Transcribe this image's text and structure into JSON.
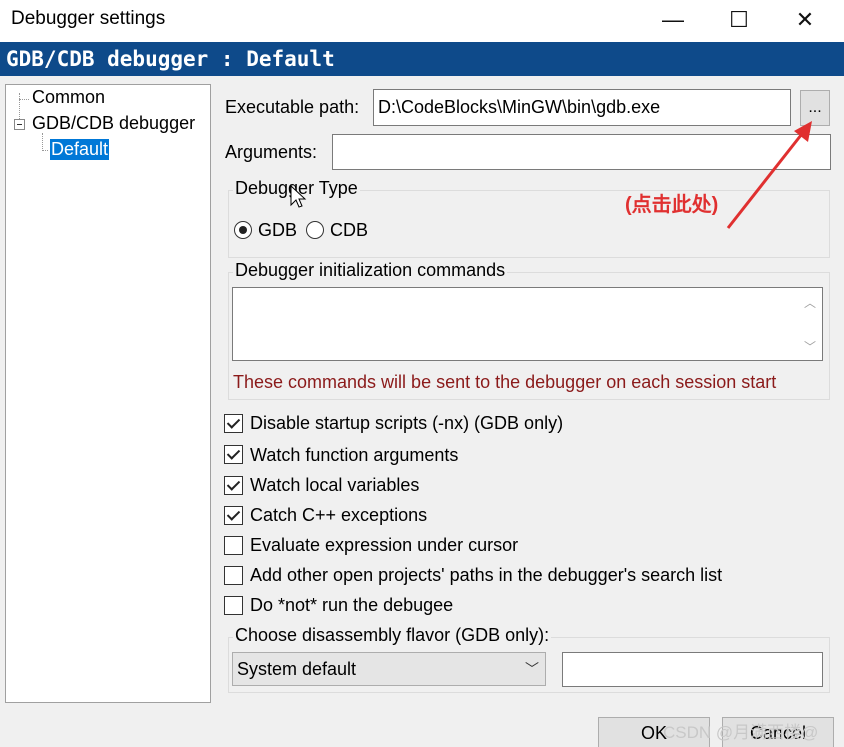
{
  "window": {
    "title": "Debugger settings",
    "minimize_label": "—",
    "maximize_label": "☐",
    "close_label": "✕"
  },
  "header": {
    "title": "GDB/CDB debugger : Default"
  },
  "tree": {
    "items": [
      {
        "label": "Common"
      },
      {
        "label": "GDB/CDB debugger"
      },
      {
        "label": "Default"
      }
    ]
  },
  "form": {
    "exe_label": "Executable path:",
    "exe_value": "D:\\CodeBlocks\\MinGW\\bin\\gdb.exe",
    "browse_label": "...",
    "args_label": "Arguments:",
    "args_value": "",
    "debugger_type": {
      "legend": "Debugger Type",
      "options": [
        "GDB",
        "CDB"
      ],
      "selected": "GDB"
    },
    "init_commands": {
      "legend": "Debugger initialization commands",
      "value": "",
      "note": "These commands will be sent to the debugger on each session start"
    },
    "checkboxes": [
      {
        "label": "Disable startup scripts (-nx) (GDB only)",
        "checked": true
      },
      {
        "label": "Watch function arguments",
        "checked": true
      },
      {
        "label": "Watch local variables",
        "checked": true
      },
      {
        "label": "Catch C++ exceptions",
        "checked": true
      },
      {
        "label": "Evaluate expression under cursor",
        "checked": false
      },
      {
        "label": "Add other open projects' paths in the debugger's search list",
        "checked": false
      },
      {
        "label": "Do *not* run the debugee",
        "checked": false
      }
    ],
    "flavor": {
      "legend": "Choose disassembly flavor (GDB only):",
      "selected": "System default",
      "extra_value": ""
    }
  },
  "footer": {
    "ok_label": "OK",
    "cancel_label": "Cancel"
  },
  "annotation": {
    "text": "(点击此处)",
    "color": "#e03030"
  },
  "watermark": {
    "text": "CSDN @月满西楼@"
  },
  "colors": {
    "header_bg": "#0e4a8a",
    "selection": "#0078d7",
    "note": "#8b1a1a"
  }
}
